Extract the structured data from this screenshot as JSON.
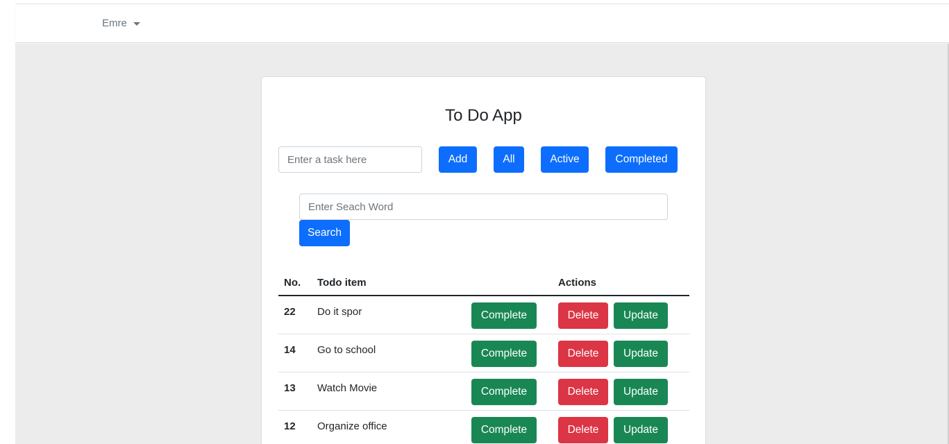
{
  "navbar": {
    "user_name": "Emre"
  },
  "app": {
    "title": "To Do App",
    "task_input_placeholder": "Enter a task here",
    "add_label": "Add",
    "filter_all_label": "All",
    "filter_active_label": "Active",
    "filter_completed_label": "Completed",
    "search_placeholder": "Enter Seach Word",
    "search_label": "Search"
  },
  "table": {
    "headers": {
      "no": "No.",
      "item": "Todo item",
      "actions": "Actions"
    },
    "rows": [
      {
        "no": "22",
        "item": "Do it spor",
        "complete": "Complete",
        "delete": "Delete",
        "update": "Update"
      },
      {
        "no": "14",
        "item": "Go to school",
        "complete": "Complete",
        "delete": "Delete",
        "update": "Update"
      },
      {
        "no": "13",
        "item": "Watch Movie",
        "complete": "Complete",
        "delete": "Delete",
        "update": "Update"
      },
      {
        "no": "12",
        "item": "Organize office",
        "complete": "Complete",
        "delete": "Delete",
        "update": "Update"
      }
    ]
  },
  "colors": {
    "primary": "#0d6efd",
    "success": "#198754",
    "danger": "#dc3545",
    "background": "#ececec"
  }
}
